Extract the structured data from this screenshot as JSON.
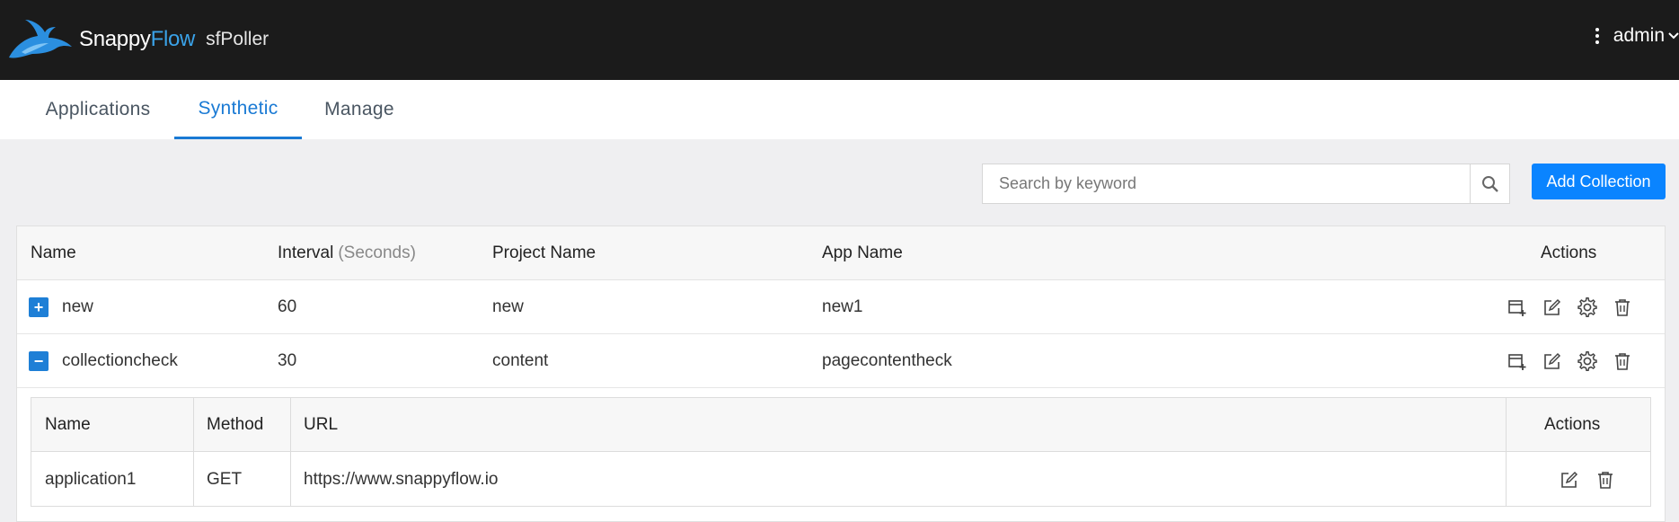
{
  "header": {
    "brand_snappy": "Snappy",
    "brand_flow": "Flow",
    "product": "sfPoller",
    "user": "admin"
  },
  "tabs": [
    {
      "label": "Applications",
      "active": false
    },
    {
      "label": "Synthetic",
      "active": true
    },
    {
      "label": "Manage",
      "active": false
    }
  ],
  "search": {
    "placeholder": "Search by keyword",
    "value": ""
  },
  "toolbar": {
    "add_label": "Add Collection"
  },
  "table": {
    "headers": {
      "name": "Name",
      "interval": "Interval",
      "interval_unit": "(Seconds)",
      "project": "Project Name",
      "app": "App Name",
      "actions": "Actions"
    },
    "rows": [
      {
        "toggle": "+",
        "name": "new",
        "interval": "60",
        "project": "new",
        "app": "new1"
      },
      {
        "toggle": "−",
        "name": "collectioncheck",
        "interval": "30",
        "project": "content",
        "app": "pagecontentheck"
      }
    ]
  },
  "subtable": {
    "headers": {
      "name": "Name",
      "method": "Method",
      "url": "URL",
      "actions": "Actions"
    },
    "rows": [
      {
        "name": "application1",
        "method": "GET",
        "url": "https://www.snappyflow.io"
      }
    ]
  },
  "colors": {
    "accent": "#1a7ad4",
    "button": "#0a84ff",
    "topbar": "#1b1b1b"
  },
  "icons": [
    "add-row-icon",
    "edit-icon",
    "gear-icon",
    "trash-icon",
    "search-icon",
    "kebab-icon",
    "chevron-down-icon",
    "rabbit-logo-icon"
  ]
}
